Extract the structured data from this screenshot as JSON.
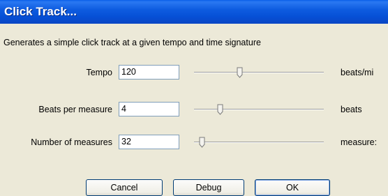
{
  "window": {
    "title": "Click Track..."
  },
  "description": "Generates a simple click track at a given tempo and time signature",
  "fields": [
    {
      "label": "Tempo",
      "value": "120",
      "unit": "beats/mi",
      "slider_level": 0.35
    },
    {
      "label": "Beats per measure",
      "value": "4",
      "unit": "beats",
      "slider_level": 0.2
    },
    {
      "label": "Number of measures",
      "value": "32",
      "unit": "measure:",
      "slider_level": 0.06
    }
  ],
  "buttons": {
    "cancel": "Cancel",
    "debug": "Debug",
    "ok": "OK"
  },
  "colors": {
    "titlebar": "#0a5fe8",
    "dialog_bg": "#ece9d8"
  }
}
